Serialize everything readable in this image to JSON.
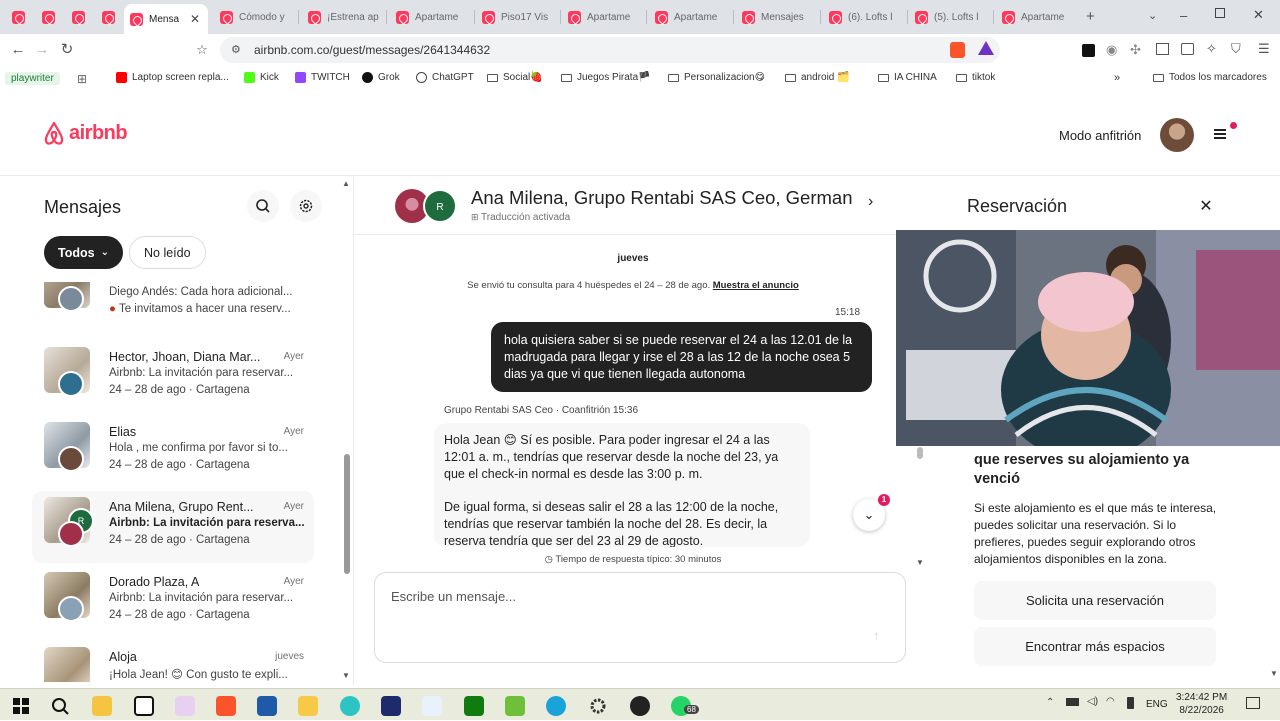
{
  "browser": {
    "tabs": [
      {
        "title": "",
        "active": false
      },
      {
        "title": "",
        "active": false
      },
      {
        "title": "",
        "active": false
      },
      {
        "title": "Mensa",
        "active": true
      },
      {
        "title": "Cómodo y",
        "active": false
      },
      {
        "title": "¡Estrena ap",
        "active": false
      },
      {
        "title": "Apartame",
        "active": false
      },
      {
        "title": "Piso17 Vis",
        "active": false
      },
      {
        "title": "Apartame",
        "active": false
      },
      {
        "title": "Apartame",
        "active": false
      },
      {
        "title": "Mensajes",
        "active": false
      },
      {
        "title": "(6). Lofts l",
        "active": false
      },
      {
        "title": "(5). Lofts l",
        "active": false
      },
      {
        "title": "Apartame",
        "active": false
      }
    ],
    "url": "airbnb.com.co/guest/messages/2641344632",
    "bookmarks": [
      {
        "label": "playwriter",
        "kind": "text"
      },
      {
        "label": "Laptop screen repla...",
        "kind": "youtube"
      },
      {
        "label": "Kick",
        "kind": "kick"
      },
      {
        "label": "TWITCH",
        "kind": "twitch"
      },
      {
        "label": "Grok",
        "kind": "grok"
      },
      {
        "label": "ChatGPT",
        "kind": "chatgpt"
      },
      {
        "label": "Social🍓",
        "kind": "folder"
      },
      {
        "label": "Juegos Pirata🏴",
        "kind": "folder"
      },
      {
        "label": "Personalizacion😋",
        "kind": "folder"
      },
      {
        "label": "android 🗂️",
        "kind": "folder"
      },
      {
        "label": "IA CHINA",
        "kind": "folder"
      },
      {
        "label": "tiktok",
        "kind": "folder"
      }
    ],
    "all_bookmarks": "Todos los marcadores"
  },
  "header": {
    "logo": "airbnb",
    "host_mode": "Modo anfitrión",
    "brand_color": "#ff385c"
  },
  "messages": {
    "title": "Mensajes",
    "filters": {
      "all": "Todos",
      "unread": "No leído"
    },
    "threads": [
      {
        "name": "",
        "time": "",
        "preview": "Diego Andés: Cada hora adicional...",
        "sub": "Te invitamos a hacer una reserv...",
        "sub_dot": true,
        "selected": false
      },
      {
        "name": "Hector, Jhoan, Diana Mar...",
        "time": "Ayer",
        "preview": "Airbnb: La invitación para reservar...",
        "sub": "24 – 28 de ago · Cartagena",
        "sub_dot": false,
        "selected": false
      },
      {
        "name": "Elias",
        "time": "Ayer",
        "preview": "Hola , me confirma por favor si to...",
        "sub": "24 – 28 de ago · Cartagena",
        "sub_dot": false,
        "selected": false
      },
      {
        "name": "Ana Milena, Grupo Rent...",
        "time": "Ayer",
        "preview": "Airbnb: La invitación para reserva...",
        "sub": "24 – 28 de ago · Cartagena",
        "sub_dot": false,
        "selected": true
      },
      {
        "name": "Dorado Plaza, A",
        "time": "Ayer",
        "preview": "Airbnb: La invitación para reservar...",
        "sub": "24 – 28 de ago · Cartagena",
        "sub_dot": false,
        "selected": false
      },
      {
        "name": "Aloja",
        "time": "jueves",
        "preview": "¡Hola Jean! 😊 Con gusto te expli...",
        "sub": "",
        "sub_dot": false,
        "selected": false
      }
    ]
  },
  "conversation": {
    "title": "Ana Milena, Grupo Rentabi SAS Ceo, German",
    "translation": "Traducción activada",
    "day": "jueves",
    "inquiry": "Se envió tu consulta para 4 huéspedes el 24 – 28 de ago.",
    "inquiry_link": "Muestra el anuncio",
    "sent_time": "15:18",
    "sent_message": "hola quisiera saber si se puede reservar el 24 a las 12.01 de la madrugada para llegar y irse el 28 a las 12 de la noche osea 5 dias ya que vi que tienen llegada autonoma",
    "reply_meta": "Grupo Rentabi SAS Ceo · Coanfitrión",
    "reply_time": "15:36",
    "reply_p1": "Hola Jean 😊 Sí es posible. Para poder ingresar el 24 a las 12:01 a. m., tendrías que reservar desde la noche del 23, ya que el check-in normal es desde las 3:00 p. m.",
    "reply_p2": "De igual forma, si deseas salir el 28 a las 12:00 de la noche, tendrías que reservar también la noche del 28. Es decir, la reserva tendría que ser del 23 al 29 de agosto.",
    "unread_count": "1",
    "response_time": "Tiempo de respuesta típico: 30 minutos",
    "composer_placeholder": "Escribe un mensaje..."
  },
  "reservation": {
    "title": "Reservación",
    "heading": "que reserves su alojamiento ya venció",
    "body": "Si este alojamiento es el que más te interesa, puedes solicitar una reservación. Si lo prefieres, puedes seguir explorando otros alojamientos disponibles en la zona.",
    "request_button": "Solicita una reservación",
    "find_button": "Encontrar más espacios"
  },
  "taskbar": {
    "time": "3:24:42 PM",
    "date": "8/22/2026",
    "language": "ENG",
    "whatsapp_badge": "68"
  }
}
